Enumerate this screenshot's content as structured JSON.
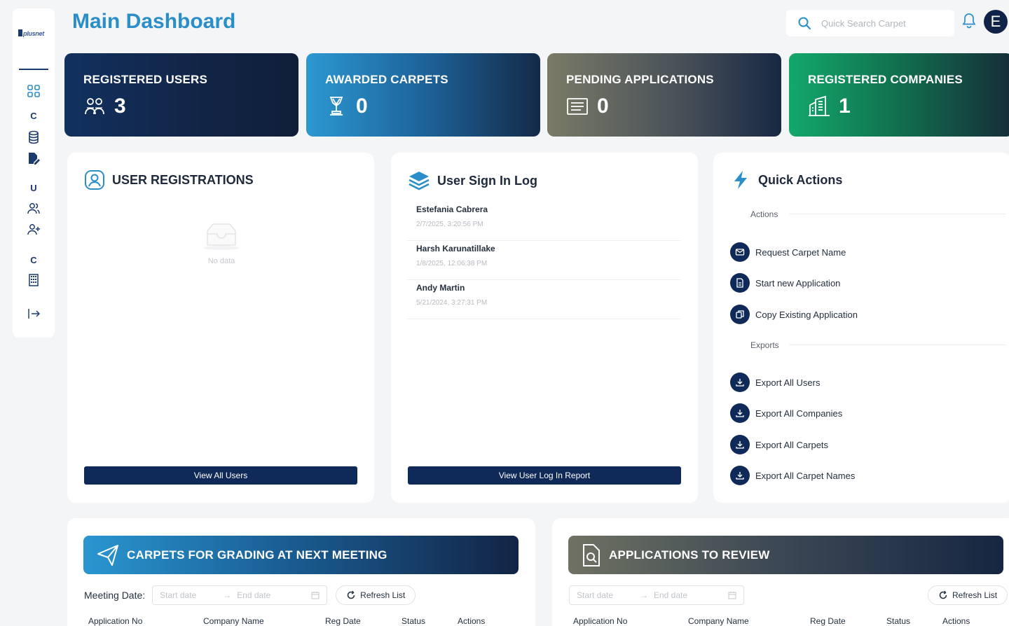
{
  "sidebar": {
    "logo_text": "plusnet",
    "section_letters": [
      "C",
      "U",
      "C"
    ]
  },
  "header": {
    "title": "Main Dashboard",
    "search_placeholder": "Quick Search Carpet",
    "avatar_initial": "E"
  },
  "stats": [
    {
      "label": "REGISTERED USERS",
      "value": "3",
      "icon": "users-icon"
    },
    {
      "label": "AWARDED CARPETS",
      "value": "0",
      "icon": "trophy-icon"
    },
    {
      "label": "PENDING APPLICATIONS",
      "value": "0",
      "icon": "document-icon"
    },
    {
      "label": "REGISTERED COMPANIES",
      "value": "1",
      "icon": "building-icon"
    }
  ],
  "user_registrations": {
    "title": "USER REGISTRATIONS",
    "empty_text": "No data",
    "button": "View All Users"
  },
  "sign_in_log": {
    "title": "User Sign In Log",
    "entries": [
      {
        "name": "Estefania Cabrera",
        "time": "2/7/2025, 3:20:56 PM"
      },
      {
        "name": "Harsh Karunatillake",
        "time": "1/8/2025, 12:06:38 PM"
      },
      {
        "name": "Andy Martin",
        "time": "5/21/2024, 3:27:31 PM"
      }
    ],
    "button": "View User Log In Report"
  },
  "quick_actions": {
    "title": "Quick Actions",
    "actions_label": "Actions",
    "actions": [
      "Request Carpet Name",
      "Start new Application",
      "Copy Existing Application"
    ],
    "exports_label": "Exports",
    "exports": [
      "Export All Users",
      "Export All Companies",
      "Export All Carpets",
      "Export All Carpet Names"
    ]
  },
  "grading": {
    "title": "CARPETS FOR GRADING AT NEXT MEETING",
    "meeting_label": "Meeting Date:",
    "start_placeholder": "Start date",
    "end_placeholder": "End date",
    "refresh": "Refresh List",
    "columns": [
      "Application No",
      "Company Name",
      "Reg Date",
      "Status",
      "Actions"
    ]
  },
  "review": {
    "title": "APPLICATIONS TO REVIEW",
    "start_placeholder": "Start date",
    "end_placeholder": "End date",
    "refresh": "Refresh List",
    "columns": [
      "Application No",
      "Company Name",
      "Reg Date",
      "Status",
      "Actions"
    ]
  }
}
